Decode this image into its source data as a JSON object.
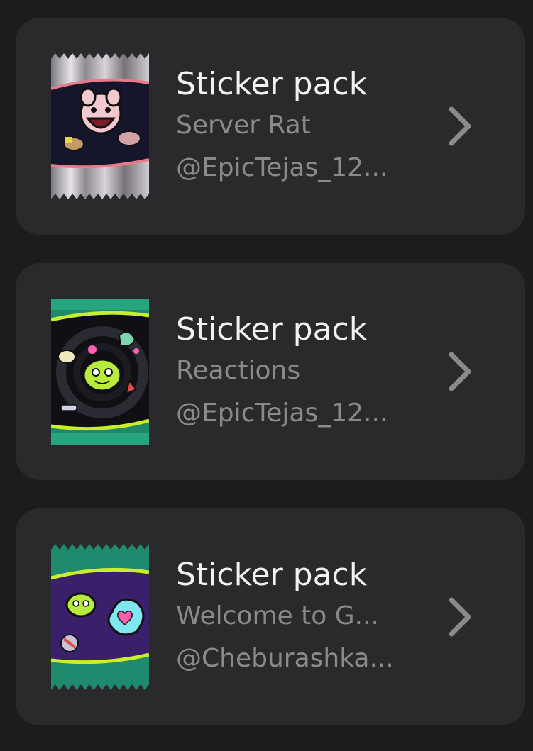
{
  "packs": [
    {
      "title": "Sticker pack",
      "name": "Server Rat",
      "author": "@EpicTejas_12...",
      "pack_icon": "server-rat-pack-icon"
    },
    {
      "title": "Sticker pack",
      "name": "Reactions",
      "author": "@EpicTejas_12...",
      "pack_icon": "reactions-pack-icon"
    },
    {
      "title": "Sticker pack",
      "name": "Welcome to G...",
      "author": "@Cheburashka...",
      "pack_icon": "welcome-pack-icon"
    }
  ],
  "icons": {
    "chevron": "chevron-right-icon"
  }
}
